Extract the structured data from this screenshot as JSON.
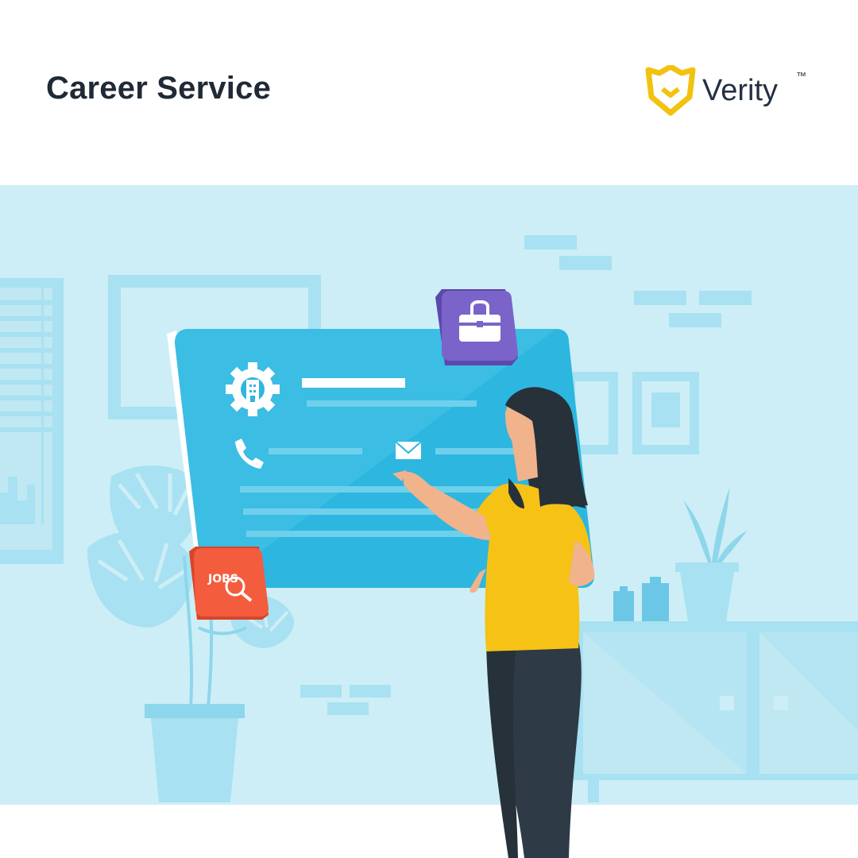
{
  "header": {
    "title": "Career Service",
    "brand": {
      "name": "Verity",
      "trademark": "™",
      "accent_color": "#F2C20F",
      "text_color": "#243140"
    }
  },
  "illustration": {
    "badge_jobs": {
      "label": "JOBS",
      "color": "#F45C3E",
      "icon": "magnifier-icon"
    },
    "badge_briefcase": {
      "color": "#7A64C9",
      "icon": "briefcase-icon"
    },
    "screen_icons": [
      "gear-building-icon",
      "phone-icon",
      "envelope-icon"
    ],
    "colors": {
      "background": "#CDEEF6",
      "furniture": "#A8E1F1",
      "screen": "#2DB6E0",
      "shirt": "#F6C215",
      "hair": "#26313A",
      "pants": "#2E3A45",
      "skin": "#F0B38C"
    }
  }
}
